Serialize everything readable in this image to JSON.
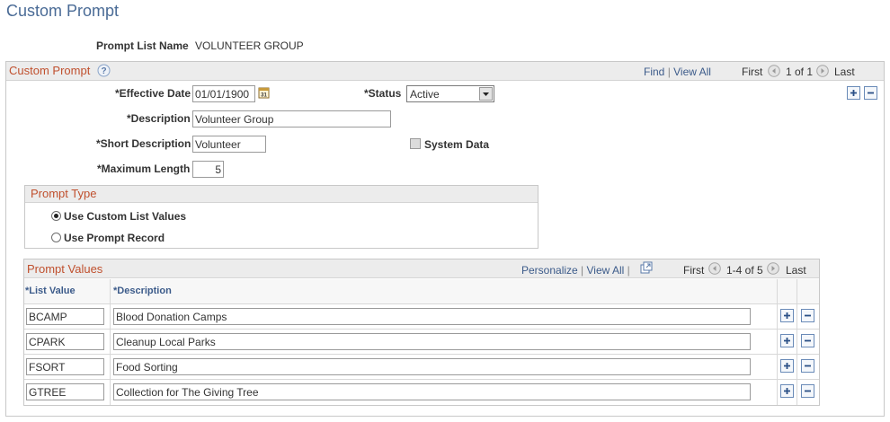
{
  "page": {
    "title": "Custom Prompt"
  },
  "header": {
    "prompt_list_name_label": "Prompt List Name",
    "prompt_list_name_value": "VOLUNTEER GROUP"
  },
  "custom_prompt": {
    "section_title": "Custom Prompt",
    "help_icon": "question-circle-icon",
    "nav": {
      "find": "Find",
      "view_all": "View All",
      "first": "First",
      "count": "1 of 1",
      "last": "Last"
    },
    "fields": {
      "effective_date_label": "*Effective Date",
      "effective_date_value": "01/01/1900",
      "status_label": "*Status",
      "status_value": "Active",
      "description_label": "*Description",
      "description_value": "Volunteer Group",
      "short_description_label": "*Short Description",
      "short_description_value": "Volunteer",
      "system_data_label": "System Data",
      "maximum_length_label": "*Maximum Length",
      "maximum_length_value": "5"
    }
  },
  "prompt_type": {
    "title": "Prompt Type",
    "options": [
      {
        "label": "Use Custom List Values",
        "selected": true
      },
      {
        "label": "Use Prompt Record",
        "selected": false
      }
    ]
  },
  "prompt_values": {
    "title": "Prompt Values",
    "nav": {
      "personalize": "Personalize",
      "view_all": "View All",
      "first": "First",
      "count": "1-4 of 5",
      "last": "Last"
    },
    "columns": {
      "list_value": "*List Value",
      "description": "*Description"
    },
    "rows": [
      {
        "value": "BCAMP",
        "description": "Blood Donation Camps"
      },
      {
        "value": "CPARK",
        "description": "Cleanup Local Parks"
      },
      {
        "value": "FSORT",
        "description": "Food Sorting"
      },
      {
        "value": "GTREE",
        "description": "Collection for The Giving Tree"
      }
    ]
  }
}
